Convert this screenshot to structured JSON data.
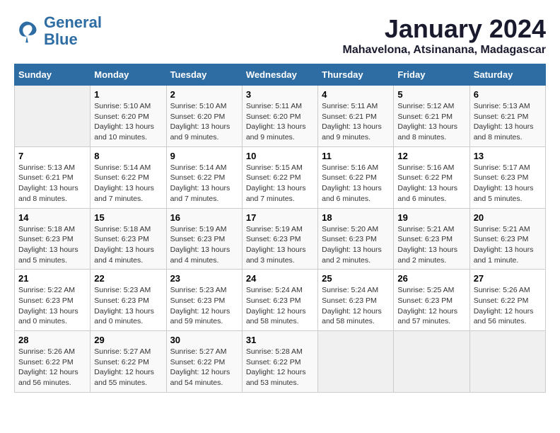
{
  "header": {
    "logo_line1": "General",
    "logo_line2": "Blue",
    "month": "January 2024",
    "location": "Mahavelona, Atsinanana, Madagascar"
  },
  "calendar": {
    "days_of_week": [
      "Sunday",
      "Monday",
      "Tuesday",
      "Wednesday",
      "Thursday",
      "Friday",
      "Saturday"
    ],
    "weeks": [
      [
        {
          "day": "",
          "content": ""
        },
        {
          "day": "1",
          "content": "Sunrise: 5:10 AM\nSunset: 6:20 PM\nDaylight: 13 hours\nand 10 minutes."
        },
        {
          "day": "2",
          "content": "Sunrise: 5:10 AM\nSunset: 6:20 PM\nDaylight: 13 hours\nand 9 minutes."
        },
        {
          "day": "3",
          "content": "Sunrise: 5:11 AM\nSunset: 6:20 PM\nDaylight: 13 hours\nand 9 minutes."
        },
        {
          "day": "4",
          "content": "Sunrise: 5:11 AM\nSunset: 6:21 PM\nDaylight: 13 hours\nand 9 minutes."
        },
        {
          "day": "5",
          "content": "Sunrise: 5:12 AM\nSunset: 6:21 PM\nDaylight: 13 hours\nand 8 minutes."
        },
        {
          "day": "6",
          "content": "Sunrise: 5:13 AM\nSunset: 6:21 PM\nDaylight: 13 hours\nand 8 minutes."
        }
      ],
      [
        {
          "day": "7",
          "content": "Sunrise: 5:13 AM\nSunset: 6:21 PM\nDaylight: 13 hours\nand 8 minutes."
        },
        {
          "day": "8",
          "content": "Sunrise: 5:14 AM\nSunset: 6:22 PM\nDaylight: 13 hours\nand 7 minutes."
        },
        {
          "day": "9",
          "content": "Sunrise: 5:14 AM\nSunset: 6:22 PM\nDaylight: 13 hours\nand 7 minutes."
        },
        {
          "day": "10",
          "content": "Sunrise: 5:15 AM\nSunset: 6:22 PM\nDaylight: 13 hours\nand 7 minutes."
        },
        {
          "day": "11",
          "content": "Sunrise: 5:16 AM\nSunset: 6:22 PM\nDaylight: 13 hours\nand 6 minutes."
        },
        {
          "day": "12",
          "content": "Sunrise: 5:16 AM\nSunset: 6:22 PM\nDaylight: 13 hours\nand 6 minutes."
        },
        {
          "day": "13",
          "content": "Sunrise: 5:17 AM\nSunset: 6:23 PM\nDaylight: 13 hours\nand 5 minutes."
        }
      ],
      [
        {
          "day": "14",
          "content": "Sunrise: 5:18 AM\nSunset: 6:23 PM\nDaylight: 13 hours\nand 5 minutes."
        },
        {
          "day": "15",
          "content": "Sunrise: 5:18 AM\nSunset: 6:23 PM\nDaylight: 13 hours\nand 4 minutes."
        },
        {
          "day": "16",
          "content": "Sunrise: 5:19 AM\nSunset: 6:23 PM\nDaylight: 13 hours\nand 4 minutes."
        },
        {
          "day": "17",
          "content": "Sunrise: 5:19 AM\nSunset: 6:23 PM\nDaylight: 13 hours\nand 3 minutes."
        },
        {
          "day": "18",
          "content": "Sunrise: 5:20 AM\nSunset: 6:23 PM\nDaylight: 13 hours\nand 2 minutes."
        },
        {
          "day": "19",
          "content": "Sunrise: 5:21 AM\nSunset: 6:23 PM\nDaylight: 13 hours\nand 2 minutes."
        },
        {
          "day": "20",
          "content": "Sunrise: 5:21 AM\nSunset: 6:23 PM\nDaylight: 13 hours\nand 1 minute."
        }
      ],
      [
        {
          "day": "21",
          "content": "Sunrise: 5:22 AM\nSunset: 6:23 PM\nDaylight: 13 hours\nand 0 minutes."
        },
        {
          "day": "22",
          "content": "Sunrise: 5:23 AM\nSunset: 6:23 PM\nDaylight: 13 hours\nand 0 minutes."
        },
        {
          "day": "23",
          "content": "Sunrise: 5:23 AM\nSunset: 6:23 PM\nDaylight: 12 hours\nand 59 minutes."
        },
        {
          "day": "24",
          "content": "Sunrise: 5:24 AM\nSunset: 6:23 PM\nDaylight: 12 hours\nand 58 minutes."
        },
        {
          "day": "25",
          "content": "Sunrise: 5:24 AM\nSunset: 6:23 PM\nDaylight: 12 hours\nand 58 minutes."
        },
        {
          "day": "26",
          "content": "Sunrise: 5:25 AM\nSunset: 6:23 PM\nDaylight: 12 hours\nand 57 minutes."
        },
        {
          "day": "27",
          "content": "Sunrise: 5:26 AM\nSunset: 6:22 PM\nDaylight: 12 hours\nand 56 minutes."
        }
      ],
      [
        {
          "day": "28",
          "content": "Sunrise: 5:26 AM\nSunset: 6:22 PM\nDaylight: 12 hours\nand 56 minutes."
        },
        {
          "day": "29",
          "content": "Sunrise: 5:27 AM\nSunset: 6:22 PM\nDaylight: 12 hours\nand 55 minutes."
        },
        {
          "day": "30",
          "content": "Sunrise: 5:27 AM\nSunset: 6:22 PM\nDaylight: 12 hours\nand 54 minutes."
        },
        {
          "day": "31",
          "content": "Sunrise: 5:28 AM\nSunset: 6:22 PM\nDaylight: 12 hours\nand 53 minutes."
        },
        {
          "day": "",
          "content": ""
        },
        {
          "day": "",
          "content": ""
        },
        {
          "day": "",
          "content": ""
        }
      ]
    ]
  }
}
